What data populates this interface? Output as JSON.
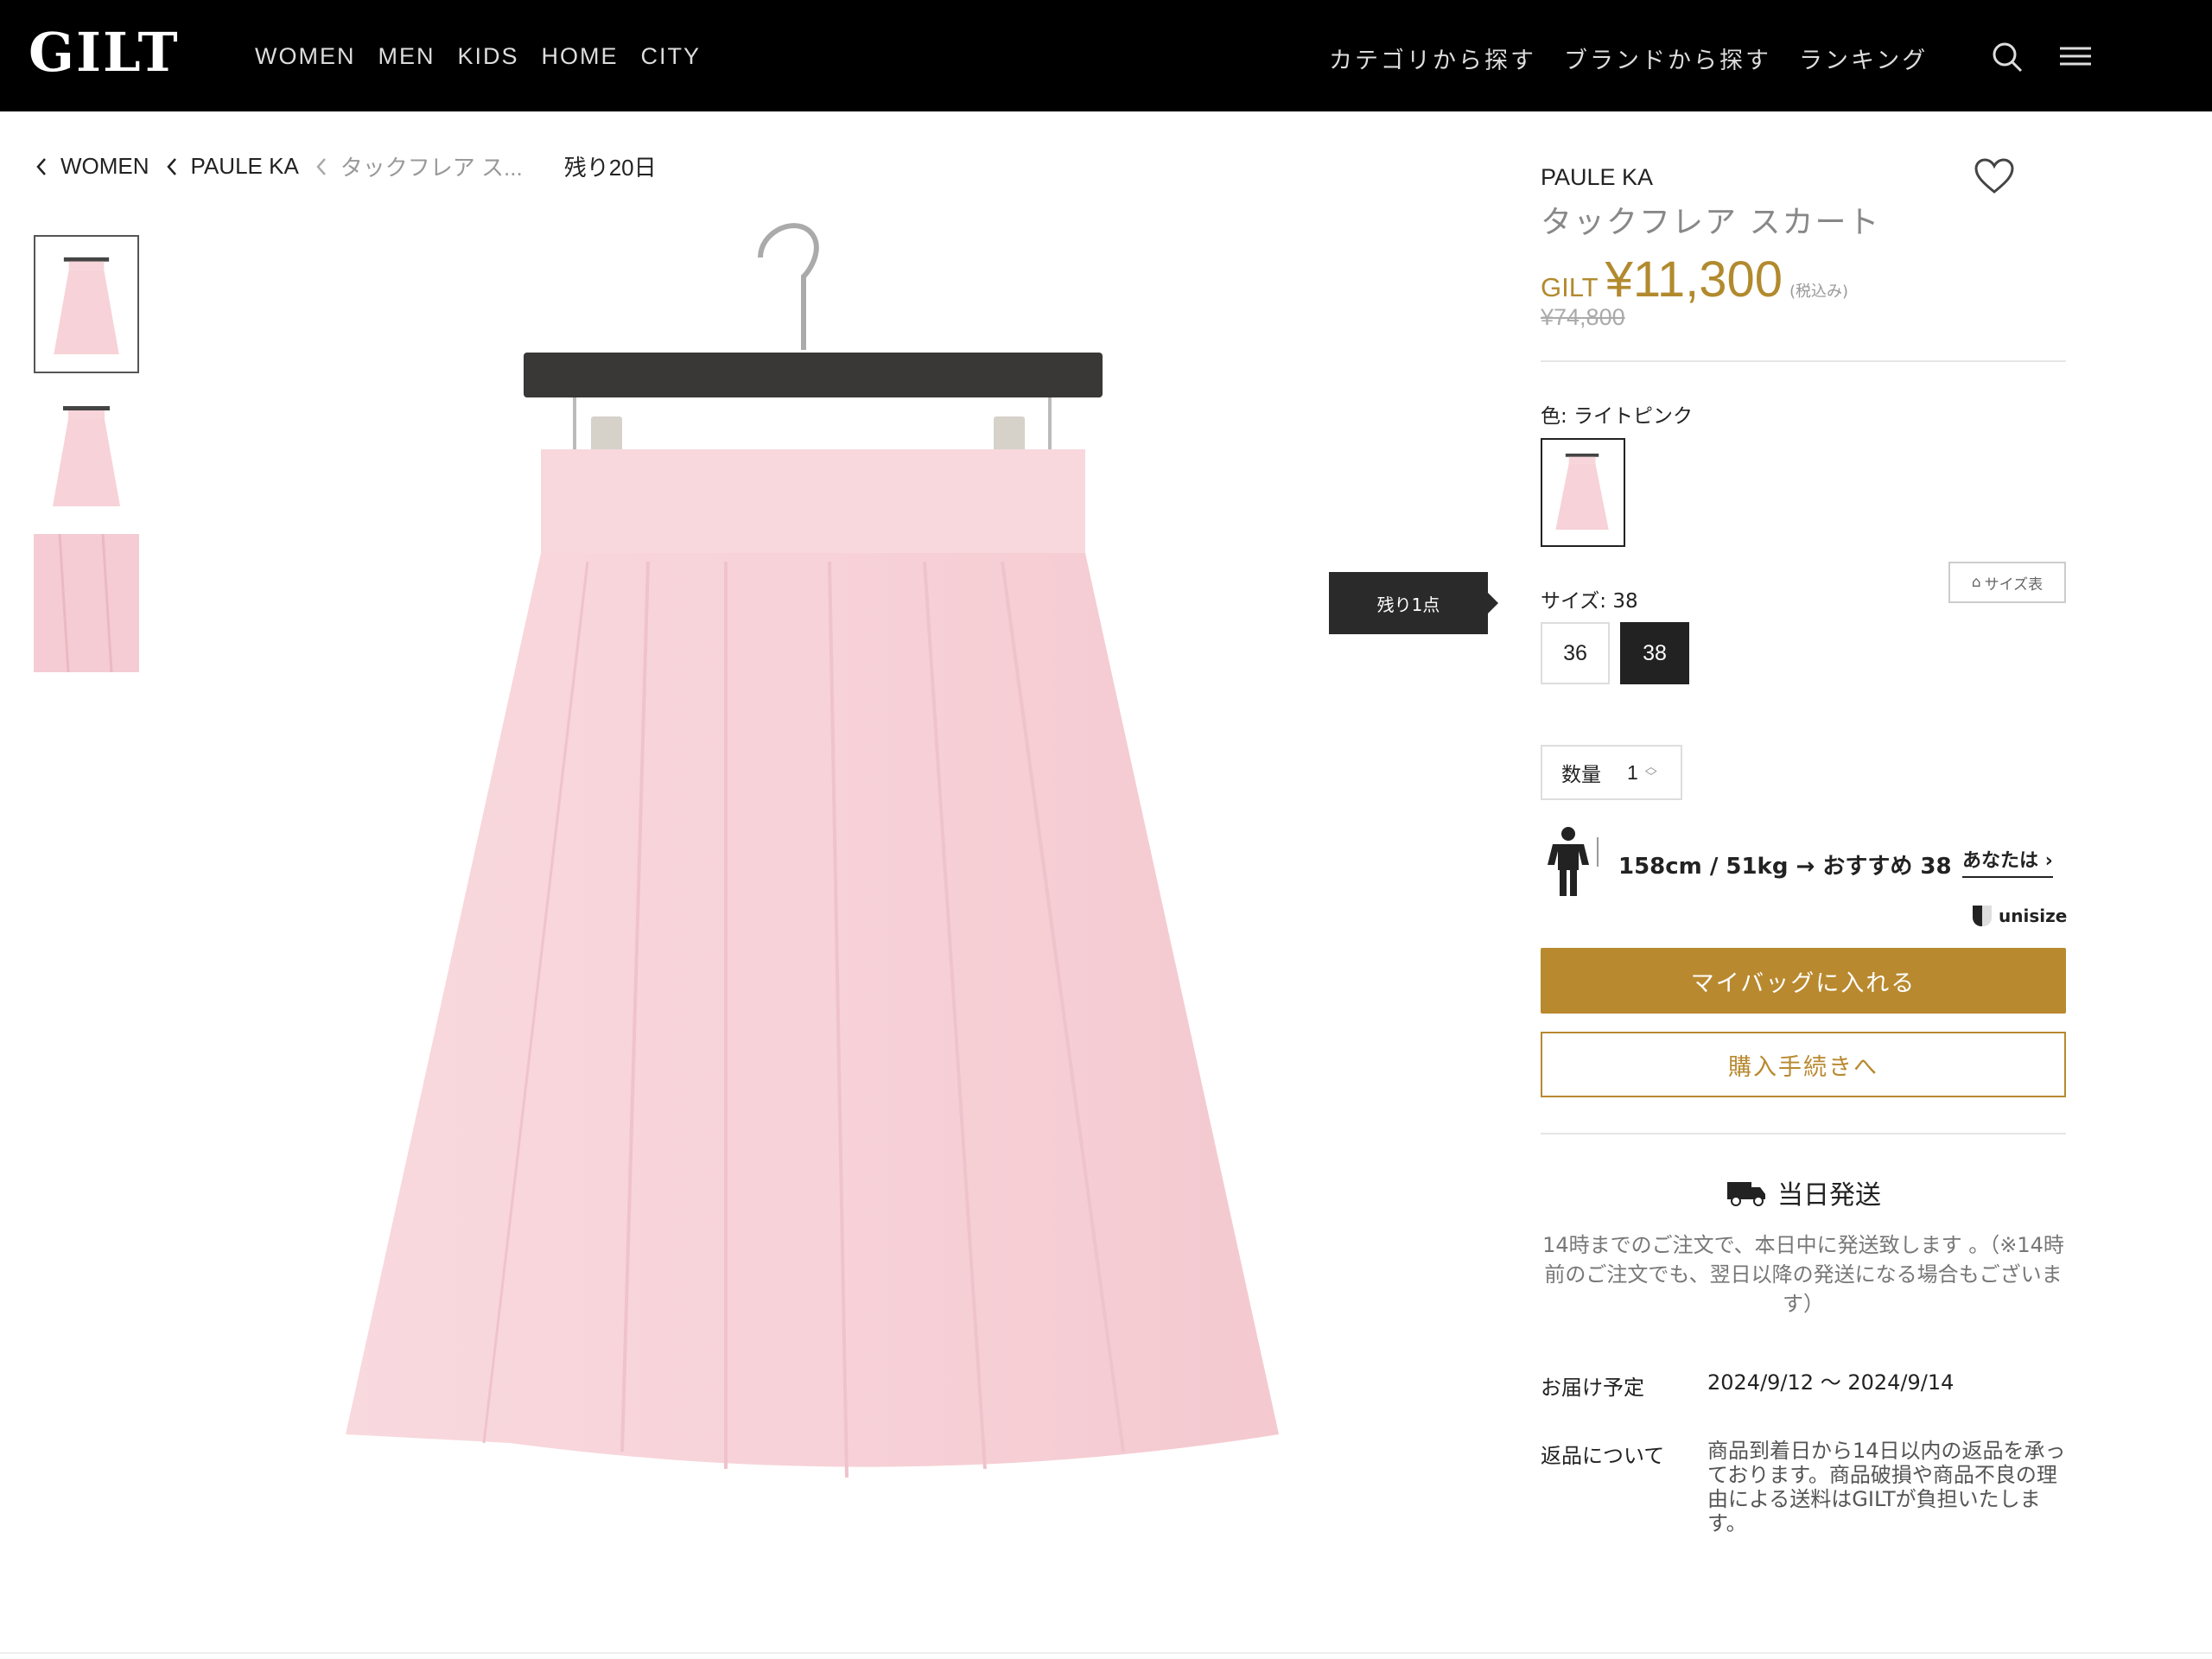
{
  "header": {
    "logo": "GILT",
    "nav": [
      "WOMEN",
      "MEN",
      "KIDS",
      "HOME",
      "CITY"
    ],
    "jp_nav": [
      "カテゴリから探す",
      "ブランドから探す",
      "ランキング"
    ],
    "icons": [
      "search-icon",
      "menu-icon"
    ]
  },
  "breadcrumb": {
    "items": [
      "WOMEN",
      "PAULE KA",
      "タックフレア ス..."
    ],
    "days_left": "残り20日"
  },
  "thumbnails": [
    "skirt-front",
    "skirt-back",
    "fabric-detail"
  ],
  "stock_tooltip": "残り1点",
  "product": {
    "brand": "PAULE KA",
    "name": "タックフレア スカート",
    "price_prefix": "GILT",
    "price": "¥11,300",
    "tax_note": "(税込み)",
    "original_price": "¥74,800",
    "color_label": "色: ライトピンク",
    "size_chart": "サイズ表",
    "size_label": "サイズ: 38",
    "sizes": [
      "36",
      "38"
    ],
    "selected_size": "38",
    "qty_label": "数量",
    "qty_value": "1",
    "recommendation": "158cm / 51kg → おすすめ 38",
    "you_link": "あなたは",
    "unisize": "unisize",
    "add_to_bag": "マイバッグに入れる",
    "checkout": "購入手続きへ"
  },
  "shipping": {
    "title": "当日発送",
    "desc": "14時までのご注文で、本日中に発送致します 。（※14時前のご注文でも、翌日以降の発送になる場合もございます）",
    "delivery_label": "お届け予定",
    "delivery_value": "2024/9/12 〜 2024/9/14",
    "returns_label": "返品について",
    "returns_value": "商品到着日から14日以内の返品を承っております。商品破損や商品不良の理由による送料はGILTが負担いたします。"
  },
  "colors": {
    "header_bg": "#000000",
    "accent_gold": "#b8892f",
    "skirt_pink": "#f7d2d8"
  }
}
